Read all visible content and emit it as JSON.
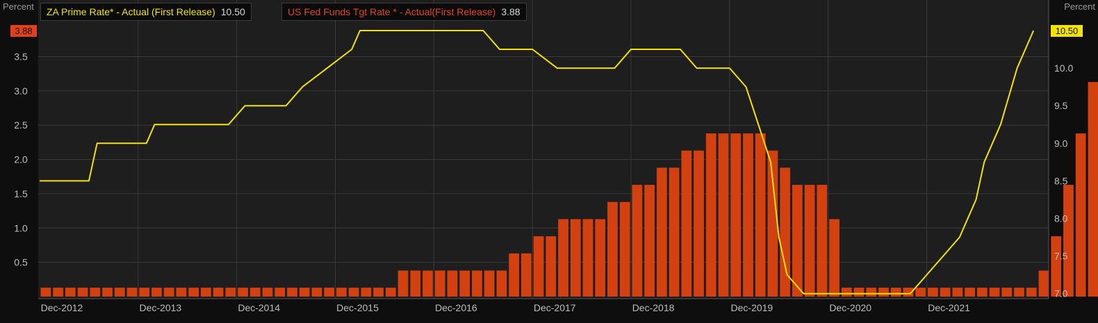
{
  "chart_data": {
    "type": "bar+line",
    "left_axis": {
      "title": "Percent",
      "ticks": [
        "0.5",
        "1.0",
        "1.5",
        "2.0",
        "2.5",
        "3.0",
        "3.5"
      ],
      "range": [
        0,
        3.88
      ]
    },
    "right_axis": {
      "title": "Percent",
      "ticks": [
        "7.0",
        "7.5",
        "8.0",
        "8.5",
        "9.0",
        "9.5",
        "10.0"
      ],
      "range": [
        6.96,
        10.5
      ]
    },
    "x_tick_labels": [
      "Dec-2012",
      "Dec-2013",
      "Dec-2014",
      "Dec-2015",
      "Dec-2016",
      "Dec-2017",
      "Dec-2018",
      "Dec-2019",
      "Dec-2020",
      "Dec-2021"
    ],
    "grid": true,
    "legend_placement": "top-left",
    "series": [
      {
        "name": "ZA Prime Rate* - Actual (First Release)",
        "last_value": "10.50",
        "kind": "line",
        "axis": "right",
        "color": "#f4e300",
        "points": [
          {
            "x": "2012-12",
            "y": 8.5
          },
          {
            "x": "2013-06",
            "y": 8.5
          },
          {
            "x": "2013-07",
            "y": 9.0
          },
          {
            "x": "2014-01",
            "y": 9.0
          },
          {
            "x": "2014-02",
            "y": 9.25
          },
          {
            "x": "2014-07",
            "y": 9.25
          },
          {
            "x": "2014-11",
            "y": 9.25
          },
          {
            "x": "2015-01",
            "y": 9.5
          },
          {
            "x": "2015-06",
            "y": 9.5
          },
          {
            "x": "2015-08",
            "y": 9.75
          },
          {
            "x": "2015-11",
            "y": 10.0
          },
          {
            "x": "2016-02",
            "y": 10.25
          },
          {
            "x": "2016-03",
            "y": 10.5
          },
          {
            "x": "2017-06",
            "y": 10.5
          },
          {
            "x": "2017-08",
            "y": 10.25
          },
          {
            "x": "2017-12",
            "y": 10.25
          },
          {
            "x": "2018-03",
            "y": 10.0
          },
          {
            "x": "2018-10",
            "y": 10.0
          },
          {
            "x": "2018-12",
            "y": 10.25
          },
          {
            "x": "2019-06",
            "y": 10.25
          },
          {
            "x": "2019-08",
            "y": 10.0
          },
          {
            "x": "2019-12",
            "y": 10.0
          },
          {
            "x": "2020-02",
            "y": 9.75
          },
          {
            "x": "2020-05",
            "y": 8.75
          },
          {
            "x": "2020-06",
            "y": 7.75
          },
          {
            "x": "2020-07",
            "y": 7.25
          },
          {
            "x": "2020-09",
            "y": 7.0
          },
          {
            "x": "2021-10",
            "y": 7.0
          },
          {
            "x": "2021-12",
            "y": 7.25
          },
          {
            "x": "2022-02",
            "y": 7.5
          },
          {
            "x": "2022-04",
            "y": 7.75
          },
          {
            "x": "2022-06",
            "y": 8.25
          },
          {
            "x": "2022-07",
            "y": 8.75
          },
          {
            "x": "2022-09",
            "y": 9.25
          },
          {
            "x": "2022-11",
            "y": 10.0
          },
          {
            "x": "2023-01",
            "y": 10.5
          }
        ]
      },
      {
        "name": "US Fed Funds Tgt Rate * - Actual(First Release)",
        "last_value": "3.88",
        "kind": "bar",
        "axis": "left",
        "color": "#d34110",
        "start": "2012-12",
        "bar_period_months": 1.5,
        "values": [
          0.13,
          0.13,
          0.13,
          0.13,
          0.13,
          0.13,
          0.13,
          0.13,
          0.13,
          0.13,
          0.13,
          0.13,
          0.13,
          0.13,
          0.13,
          0.13,
          0.13,
          0.13,
          0.13,
          0.13,
          0.13,
          0.13,
          0.13,
          0.13,
          0.13,
          0.13,
          0.13,
          0.13,
          0.13,
          0.38,
          0.38,
          0.38,
          0.38,
          0.38,
          0.38,
          0.38,
          0.38,
          0.38,
          0.63,
          0.63,
          0.88,
          0.88,
          1.13,
          1.13,
          1.13,
          1.13,
          1.38,
          1.38,
          1.63,
          1.63,
          1.88,
          1.88,
          2.13,
          2.13,
          2.38,
          2.38,
          2.38,
          2.38,
          2.38,
          2.13,
          1.88,
          1.63,
          1.63,
          1.63,
          1.13,
          0.13,
          0.13,
          0.13,
          0.13,
          0.13,
          0.13,
          0.13,
          0.13,
          0.13,
          0.13,
          0.13,
          0.13,
          0.13,
          0.13,
          0.13,
          0.13,
          0.38,
          0.88,
          1.63,
          2.38,
          3.13,
          3.88
        ]
      }
    ]
  }
}
